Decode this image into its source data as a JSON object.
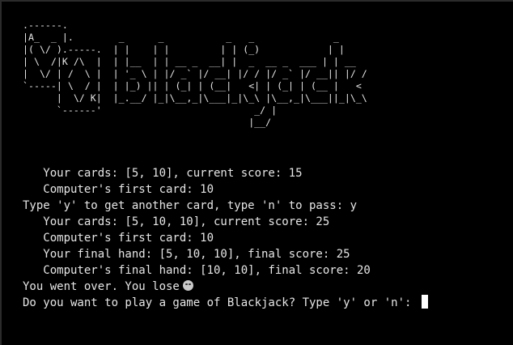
{
  "logo": {
    "art_lines": [
      ".------.                                                          ",
      "|A_  _ |.        _      _           _   _              _          ",
      "|( \\/ ).-----.  | |    | |         | | (_)            | |         ",
      "| \\  /|K /\\  |  | |__  | | __ _  __| |  _  __ _  ___ | | __      ",
      "|  \\/ | /  \\ |  | '_ \\ | |/ _` |/ __| |/ / |/ _` |/ __|| |/ /     ",
      "`-----| \\  / |  | |_) || | (_| | (__|   <| | (_| | (__ |   <      ",
      "      |  \\/ K|  |_.__/ |_|\\__,_|\\___|_|\\_\\ |\\__,_|\\___||_|\\_\\     ",
      "      `------'                           _/ |                      ",
      "                                        |__/                       "
    ]
  },
  "console": {
    "lines": [
      "   Your cards: [5, 10], current score: 15",
      "   Computer's first card: 10",
      "Type 'y' to get another card, type 'n' to pass: y",
      "   Your cards: [5, 10, 10], current score: 25",
      "   Computer's first card: 10",
      "   Your final hand: [5, 10, 10], final score: 25",
      "   Computer's final hand: [10, 10], final score: 20"
    ],
    "result_text": "You went over. You lose",
    "result_emoji": "crying-face-icon",
    "prompt_text": "Do you want to play a game of Blackjack? Type 'y' or 'n': "
  }
}
